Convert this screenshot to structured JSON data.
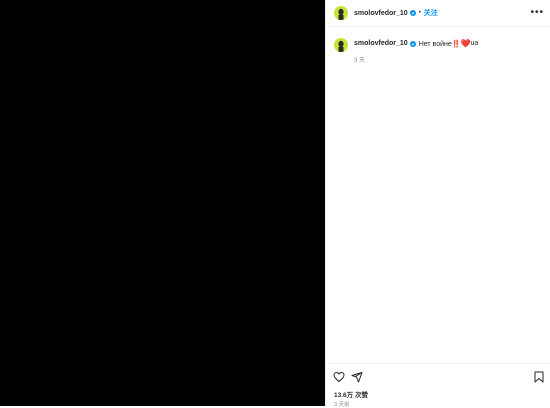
{
  "header": {
    "username": "smolovfedor_10",
    "separator": "•",
    "follow_label": "关注",
    "more_label": "•••"
  },
  "comment": {
    "username": "smolovfedor_10",
    "text": "Нет войне‼️",
    "emoji": "❤️",
    "suffix": "ua",
    "time": "3 天"
  },
  "footer": {
    "likes": "13.6万 次赞",
    "age": "3 天前"
  },
  "colors": {
    "avatar_bg": "#c8e23f",
    "link_blue": "#0095f6",
    "heart": "#e0245e",
    "media_bg": "#000000"
  },
  "icons": [
    "verified-badge-icon",
    "heart-outline-icon",
    "share-icon",
    "bookmark-icon",
    "more-icon"
  ]
}
